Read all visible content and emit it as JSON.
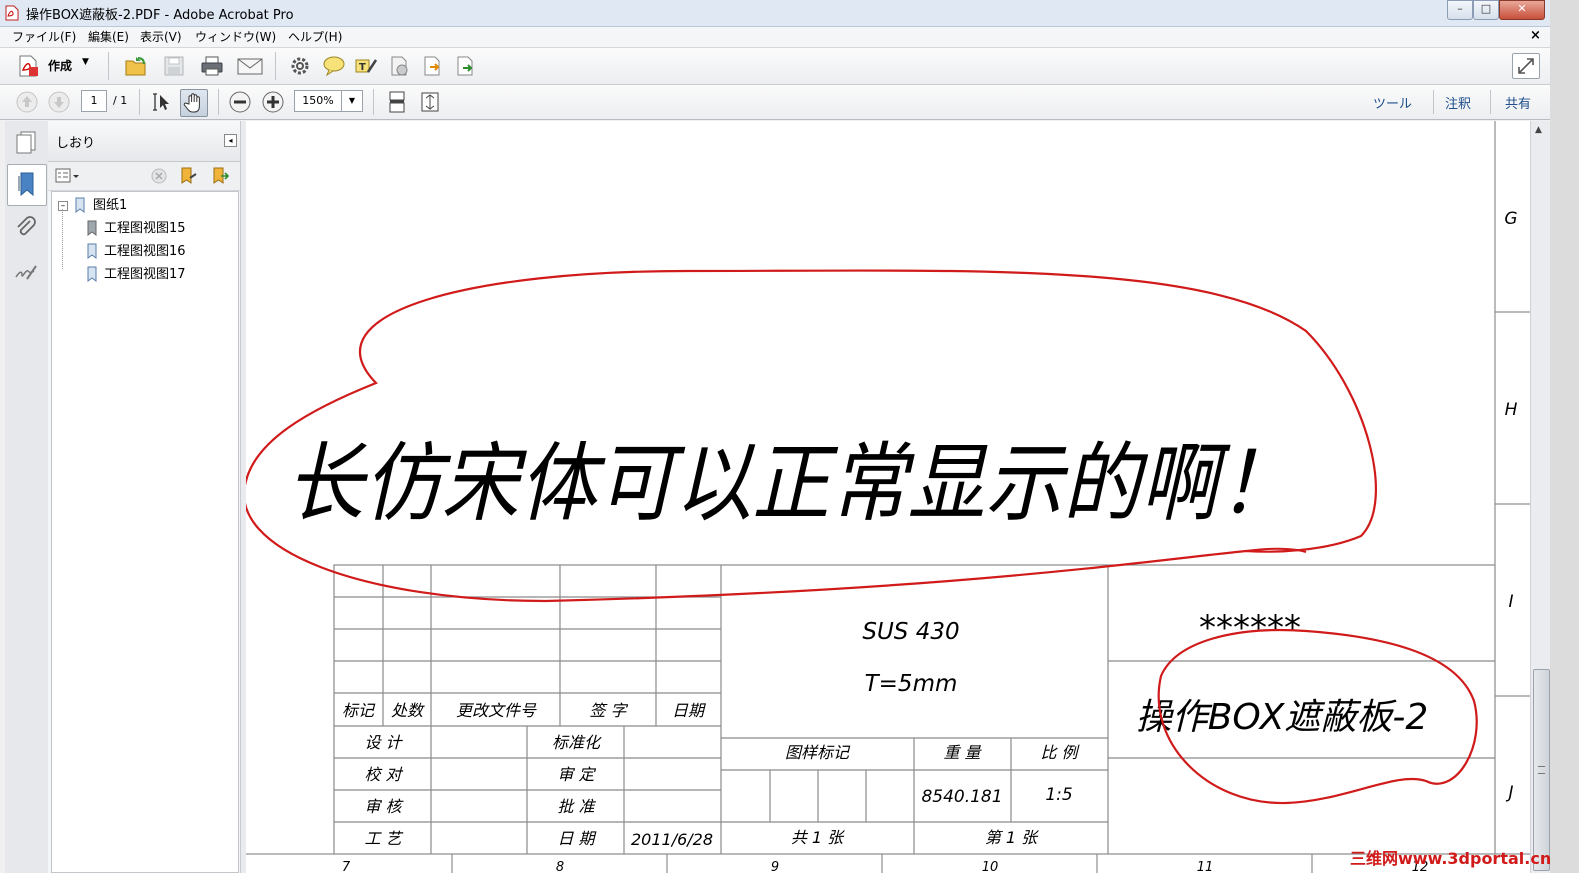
{
  "window": {
    "title": "操作BOX遮蔽板-2.PDF - Adobe Acrobat Pro",
    "controls": {
      "minimize": "–",
      "maximize": "□",
      "close": "✕"
    }
  },
  "menubar": {
    "items": [
      "ファイル(F)",
      "編集(E)",
      "表示(V)",
      "ウィンドウ(W)",
      "ヘルプ(H)"
    ],
    "close": "×"
  },
  "toolbar": {
    "create_label": "作成",
    "page_current": "1",
    "page_total": "/ 1",
    "zoom": "150%",
    "right_links": [
      "ツール",
      "注釈",
      "共有"
    ]
  },
  "bookmarks": {
    "title": "しおり",
    "root": "图纸1",
    "children": [
      "工程图视图15",
      "工程图视图16",
      "工程图视图17"
    ]
  },
  "drawing": {
    "handwritten_note": "长仿宋体可以正常显示的啊！",
    "row_markers": [
      "G",
      "H",
      "I",
      "J"
    ],
    "bottom_numbers": [
      "7",
      "8",
      "9",
      "10",
      "11",
      "12"
    ],
    "material": "SUS 430",
    "thickness": "T=5mm",
    "company": "******",
    "part_name": "操作BOX遮蔽板-2",
    "revision_headers": [
      "标记",
      "处数",
      "更改文件号",
      "签 字",
      "日期"
    ],
    "roles": [
      "设 计",
      "校 对",
      "审 核",
      "工 艺"
    ],
    "approvals": [
      "标准化",
      "审 定",
      "批 准",
      "日 期"
    ],
    "date": "2011/6/28",
    "mark_label": "图样标记",
    "weight_label": "重 量",
    "scale_label": "比 例",
    "weight": "8540.181",
    "scale": "1:5",
    "total_sheets": "共 1 张",
    "sheet_no": "第 1 张"
  },
  "watermark": "三维网www.3dportal.cn",
  "colors": {
    "annotation_red": "#d11a1a",
    "link_blue": "#1e4f8c"
  }
}
